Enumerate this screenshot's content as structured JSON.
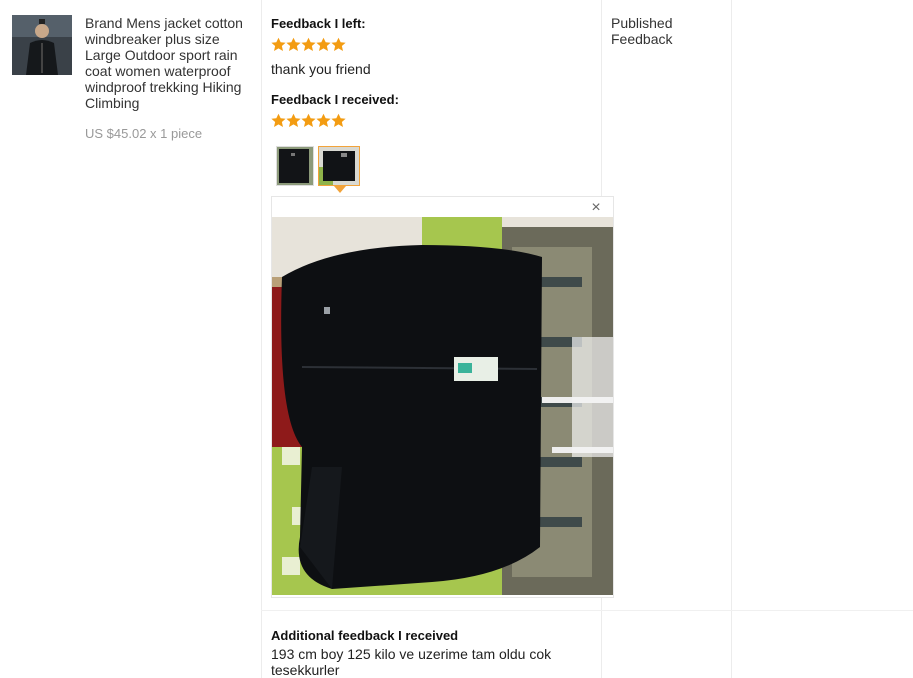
{
  "product": {
    "name": "Brand Mens jacket cotton windbreaker plus size Large Outdoor sport rain coat women waterproof windproof trekking Hiking Climbing",
    "price": "US $45.02 x 1 piece",
    "thumbnail_icon": "product-jacket-image"
  },
  "feedback_left": {
    "label": "Feedback I left:",
    "stars": 5,
    "comment": "thank you friend"
  },
  "feedback_received": {
    "label": "Feedback I received:",
    "stars": 5,
    "photo_count": 2,
    "selected_photo": 2
  },
  "popup": {
    "close_label": "×"
  },
  "status": {
    "text": "Published Feedback"
  },
  "additional_feedback": {
    "label": "Additional feedback I received",
    "text": "193 cm boy 125 kilo ve uzerime tam oldu cok tesekkurler"
  },
  "colors": {
    "star": "#f39c12",
    "selected_border": "#f2a33a",
    "divider": "#ececec"
  }
}
